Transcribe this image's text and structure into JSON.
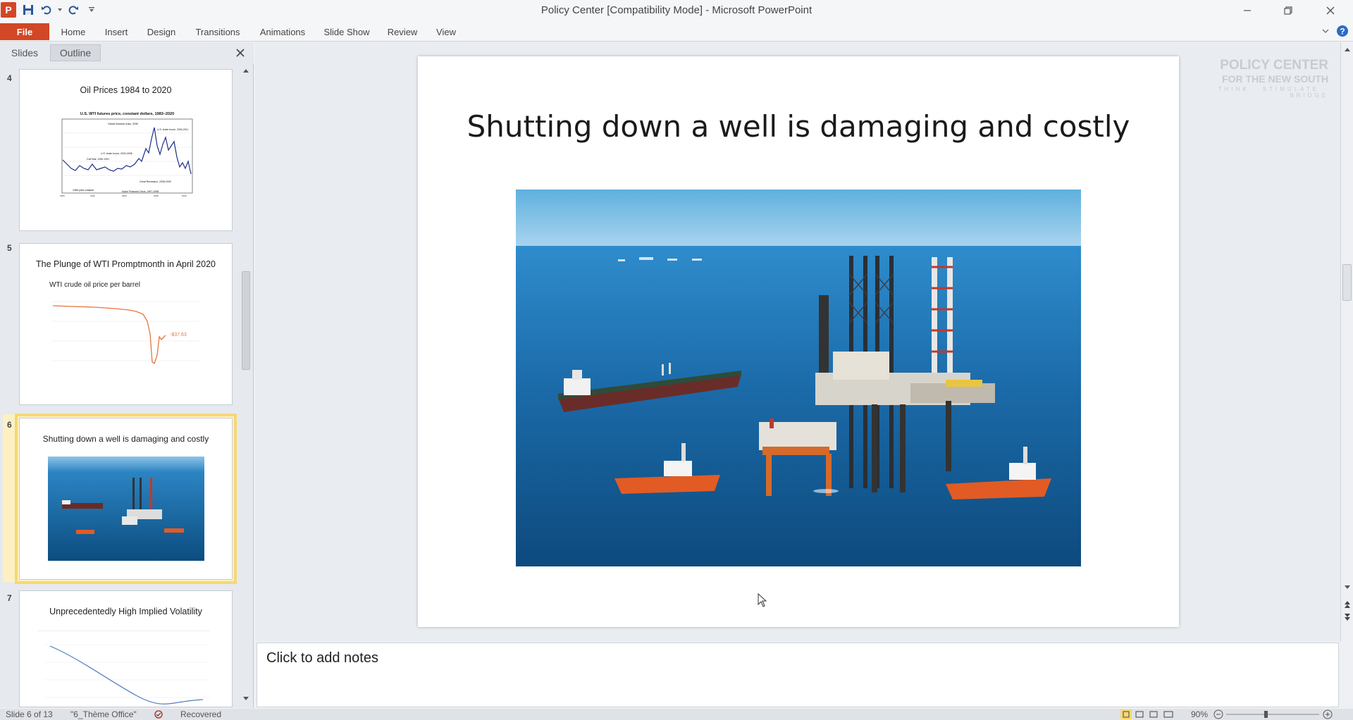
{
  "window": {
    "title": "Policy Center [Compatibility Mode]  -  Microsoft PowerPoint",
    "app_logo_letter": "P"
  },
  "ribbon": {
    "tabs": [
      "File",
      "Home",
      "Insert",
      "Design",
      "Transitions",
      "Animations",
      "Slide Show",
      "Review",
      "View"
    ]
  },
  "panel": {
    "tabs": [
      "Slides",
      "Outline"
    ]
  },
  "thumbnails": [
    {
      "number": "4",
      "title": "Oil Prices 1984 to 2020",
      "chart_caption": "U.S. WTI futures price, constant dollars, 1983–2020"
    },
    {
      "number": "5",
      "title": "The Plunge of WTI Promptmonth  in April 2020",
      "chart_caption": "WTI crude oil price per barrel",
      "end_label": "-$37.63"
    },
    {
      "number": "6",
      "title": "Shutting down a well is damaging and costly"
    },
    {
      "number": "7",
      "title": "Unprecedentedly  High Implied Volatility"
    }
  ],
  "slide": {
    "title": "Shutting down a well is damaging and costly"
  },
  "watermark": {
    "line1": "POLICY CENTER",
    "line2": "FOR THE NEW SOUTH",
    "line3": "THINK · STIMULATE · BRIDGE"
  },
  "notes": {
    "placeholder": "Click to add notes"
  },
  "status": {
    "slide_counter": "Slide 6 of 13",
    "theme": "\"6_Thème Office\"",
    "recovered": "Recovered",
    "zoom": "90%"
  },
  "colors": {
    "file_tab": "#d24726",
    "selection": "#f6d774",
    "sea": "#1d6fa8"
  }
}
